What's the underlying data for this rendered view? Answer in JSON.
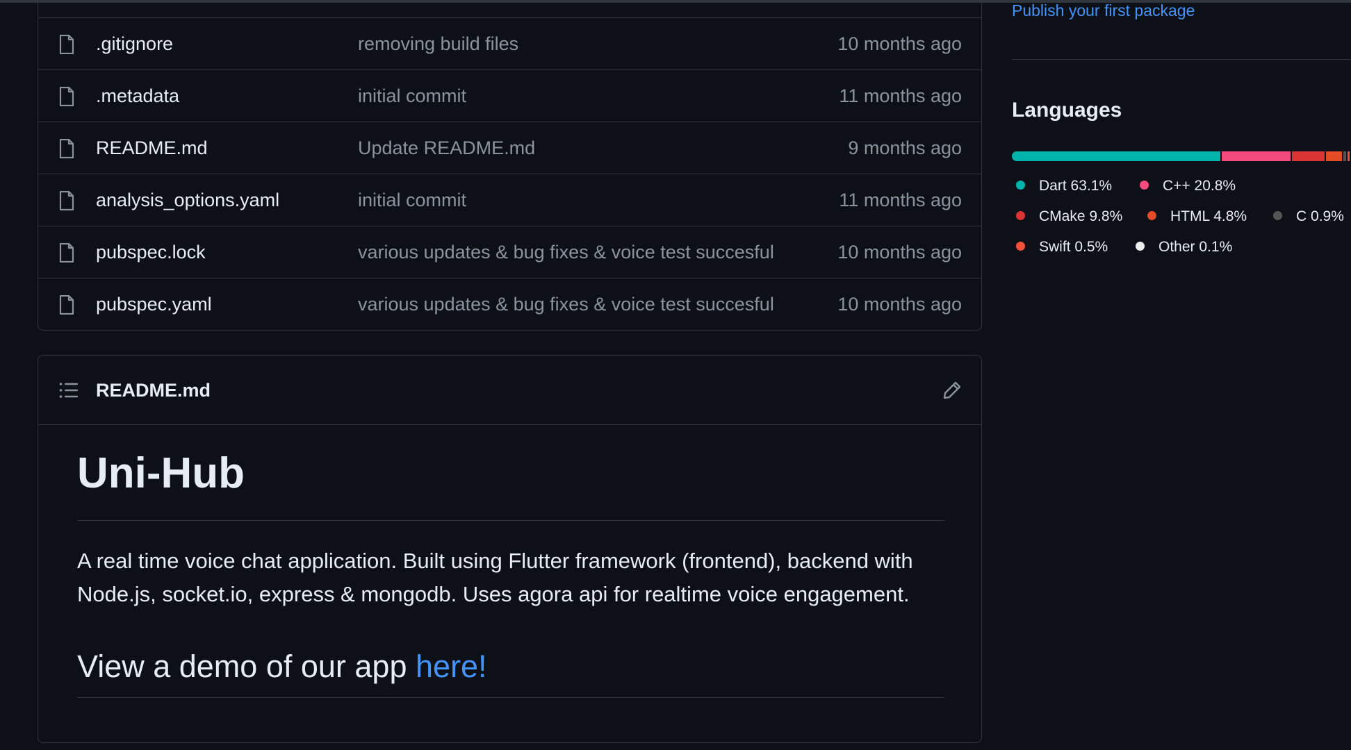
{
  "files": [
    {
      "name": ".gitignore",
      "commit": "removing build files",
      "date": "10 months ago"
    },
    {
      "name": ".metadata",
      "commit": "initial commit",
      "date": "11 months ago"
    },
    {
      "name": "README.md",
      "commit": "Update README.md",
      "date": "9 months ago"
    },
    {
      "name": "analysis_options.yaml",
      "commit": "initial commit",
      "date": "11 months ago"
    },
    {
      "name": "pubspec.lock",
      "commit": "various updates & bug fixes & voice test succesful",
      "date": "10 months ago"
    },
    {
      "name": "pubspec.yaml",
      "commit": "various updates & bug fixes & voice test succesful",
      "date": "10 months ago"
    }
  ],
  "readme": {
    "filename": "README.md",
    "title": "Uni-Hub",
    "paragraph": "A real time voice chat application. Built using Flutter framework (frontend), backend with Node.js, socket.io, express & mongodb. Uses agora api for realtime voice engagement.",
    "demo_text": "View a demo of our app ",
    "demo_link": "here!"
  },
  "sidebar": {
    "publish_link": "Publish your first package",
    "languages_title": "Languages",
    "languages": [
      {
        "name": "Dart",
        "percent": "63.1%",
        "value": 63.1,
        "color": "#00b4ab"
      },
      {
        "name": "C++",
        "percent": "20.8%",
        "value": 20.8,
        "color": "#f34b7d"
      },
      {
        "name": "CMake",
        "percent": "9.8%",
        "value": 9.8,
        "color": "#da3434"
      },
      {
        "name": "HTML",
        "percent": "4.8%",
        "value": 4.8,
        "color": "#e34c26"
      },
      {
        "name": "C",
        "percent": "0.9%",
        "value": 0.9,
        "color": "#555555"
      },
      {
        "name": "Swift",
        "percent": "0.5%",
        "value": 0.5,
        "color": "#f05138"
      },
      {
        "name": "Other",
        "percent": "0.1%",
        "value": 0.1,
        "color": "#ededed"
      }
    ]
  },
  "colors": {
    "background": "#0d1117",
    "border": "#30363d",
    "muted_text": "#8b949e",
    "link": "#4493f8"
  }
}
